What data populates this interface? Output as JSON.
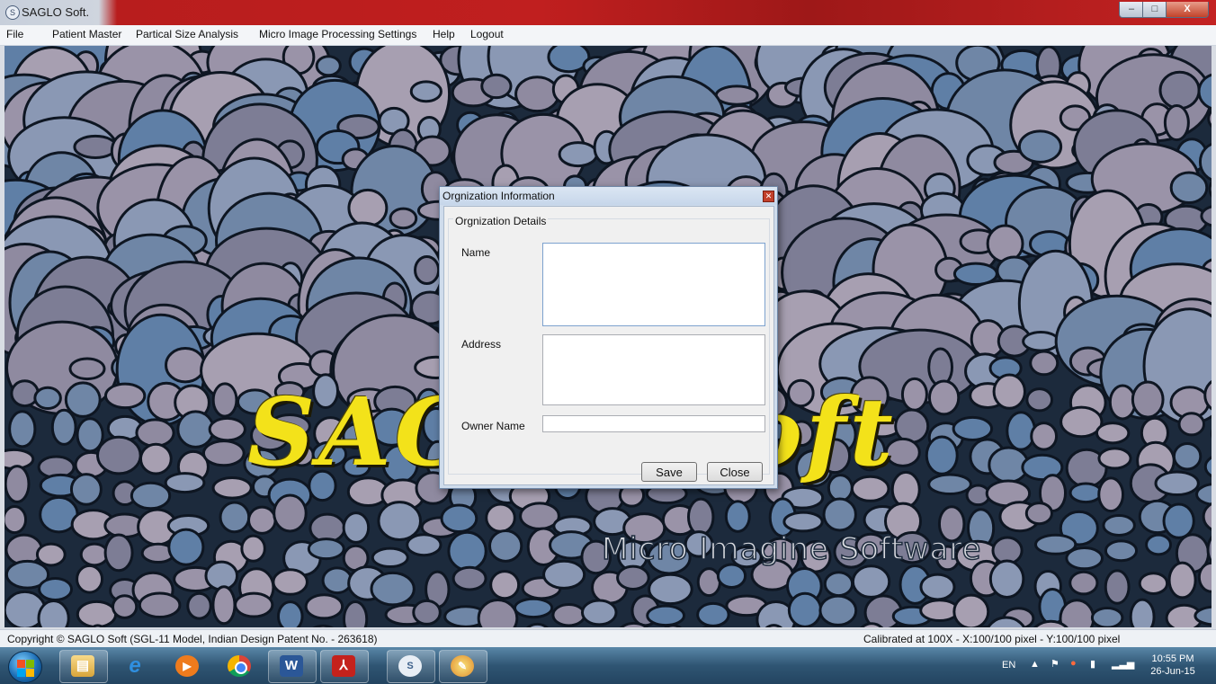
{
  "window": {
    "title": "SAGLO Soft.",
    "icon": "saglo-app-icon"
  },
  "window_controls": {
    "minimize": "–",
    "maximize": "□",
    "close": "X"
  },
  "menu": [
    "File",
    "Patient Master",
    "Partical Size Analysis",
    "Micro Image Processing",
    "Settings",
    "Help",
    "Logout"
  ],
  "background": {
    "brand": "SAGLO Soft",
    "tagline": "Micro Imagine Software"
  },
  "dialog": {
    "title": "Orgnization Information",
    "close_icon": "close-icon",
    "group_title": "Orgnization Details",
    "fields": {
      "name": {
        "label": "Name",
        "value": ""
      },
      "address": {
        "label": "Address",
        "value": ""
      },
      "owner": {
        "label": "Owner Name",
        "value": ""
      }
    },
    "buttons": {
      "save": "Save",
      "close": "Close"
    }
  },
  "status": {
    "copyright": "Copyright © SAGLO Soft (SGL-11 Model, Indian Design Patent No. - 263618)",
    "calibration": "Calibrated at  100X - X:100/100 pixel  - Y:100/100 pixel"
  },
  "taskbar": {
    "apps": [
      "start-orb-icon",
      "file-explorer-icon",
      "internet-explorer-icon",
      "media-player-icon",
      "chrome-icon",
      "word-icon",
      "acrobat-icon",
      "saglo-icon",
      "paint-icon"
    ],
    "tray": {
      "language": "EN",
      "time": "10:55 PM",
      "date": "26-Jun-15"
    }
  },
  "colors": {
    "brand_yellow": "#f3e21a",
    "titlebar_red": "#c01f1f",
    "taskbar_blue": "#2f5573"
  }
}
